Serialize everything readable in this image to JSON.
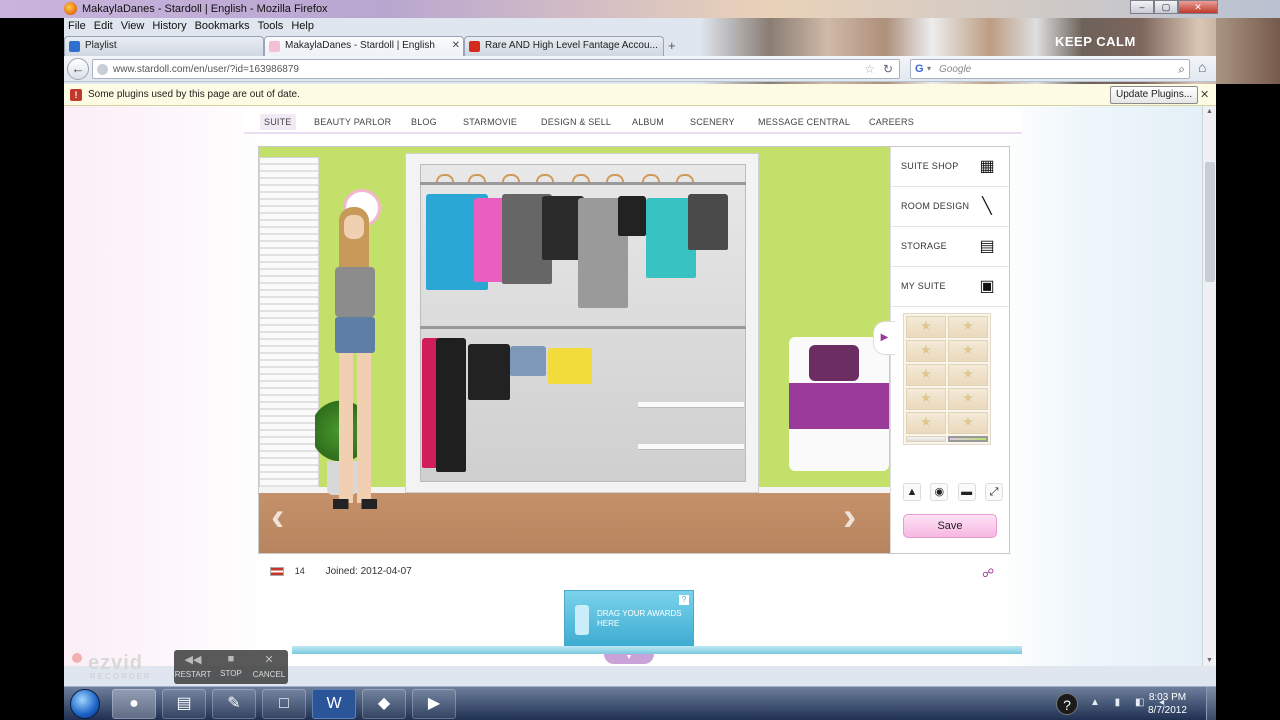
{
  "window": {
    "title": "MakaylaDanes - Stardoll | English - Mozilla Firefox",
    "controls": [
      "–",
      "▢",
      "✕"
    ]
  },
  "menu": [
    "File",
    "Edit",
    "View",
    "History",
    "Bookmarks",
    "Tools",
    "Help"
  ],
  "background_text": "KEEP CALM",
  "tabs": [
    {
      "label": "Playlist",
      "icon": "blue-list-icon",
      "active": false
    },
    {
      "label": "MakaylaDanes - Stardoll | English",
      "icon": "stardoll-icon",
      "active": true
    },
    {
      "label": "Rare AND High Level Fantage Accou...",
      "icon": "youtube-icon",
      "active": false
    }
  ],
  "new_tab": "+",
  "navbar": {
    "url": "www.stardoll.com/en/user/?id=163986879",
    "search_placeholder": "Google"
  },
  "notification": {
    "message": "Some plugins used by this page are out of date.",
    "button": "Update Plugins...",
    "close": "✕"
  },
  "page_nav": [
    "SUITE",
    "BEAUTY PARLOR",
    "BLOG",
    "STARMOVIE",
    "DESIGN & SELL",
    "ALBUM",
    "SCENERY",
    "MESSAGE CENTRAL",
    "CAREERS"
  ],
  "side_panel": {
    "items": [
      {
        "label": "SUITE SHOP",
        "icon": "shopping-bag-icon"
      },
      {
        "label": "ROOM DESIGN",
        "icon": "brush-icon"
      },
      {
        "label": "STORAGE",
        "icon": "dresser-icon"
      },
      {
        "label": "MY SUITE",
        "icon": "suite-icon"
      }
    ],
    "save": "Save"
  },
  "user": {
    "count": "14",
    "joined": "Joined: 2012-04-07"
  },
  "awards": {
    "text": "DRAG YOUR AWARDS HERE",
    "help": "?"
  },
  "ezvid": {
    "logo": "ezvid",
    "sub": "RECORDER",
    "controls": [
      "RESTART",
      "STOP",
      "CANCEL"
    ]
  },
  "taskbar": {
    "time": "8:03 PM",
    "date": "8/7/2012"
  }
}
